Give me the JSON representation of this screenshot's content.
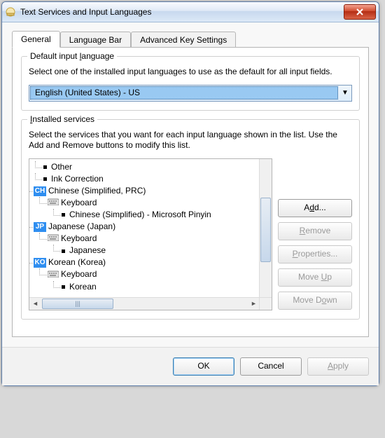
{
  "window": {
    "title": "Text Services and Input Languages"
  },
  "tabs": [
    {
      "label": "General"
    },
    {
      "label": "Language Bar"
    },
    {
      "label": "Advanced Key Settings"
    }
  ],
  "default_lang": {
    "group_title": "Default input language",
    "desc": "Select one of the installed input languages to use as the default for all input fields.",
    "selected": "English (United States) - US"
  },
  "installed": {
    "group_title": "Installed services",
    "desc": "Select the services that you want for each input language shown in the list. Use the Add and Remove buttons to modify this list.",
    "tree": {
      "extra_items": [
        "Other",
        "Ink Correction"
      ],
      "langs": [
        {
          "badge": "CH",
          "name": "Chinese (Simplified, PRC)",
          "keyboard_label": "Keyboard",
          "layouts": [
            "Chinese (Simplified) - Microsoft Pinyin"
          ]
        },
        {
          "badge": "JP",
          "name": "Japanese (Japan)",
          "keyboard_label": "Keyboard",
          "layouts": [
            "Japanese"
          ]
        },
        {
          "badge": "KO",
          "name": "Korean (Korea)",
          "keyboard_label": "Keyboard",
          "layouts": [
            "Korean"
          ]
        }
      ]
    },
    "buttons": {
      "add": "Add...",
      "remove": "Remove",
      "properties": "Properties...",
      "move_up": "Move Up",
      "move_down": "Move Down"
    }
  },
  "footer": {
    "ok": "OK",
    "cancel": "Cancel",
    "apply": "Apply"
  }
}
